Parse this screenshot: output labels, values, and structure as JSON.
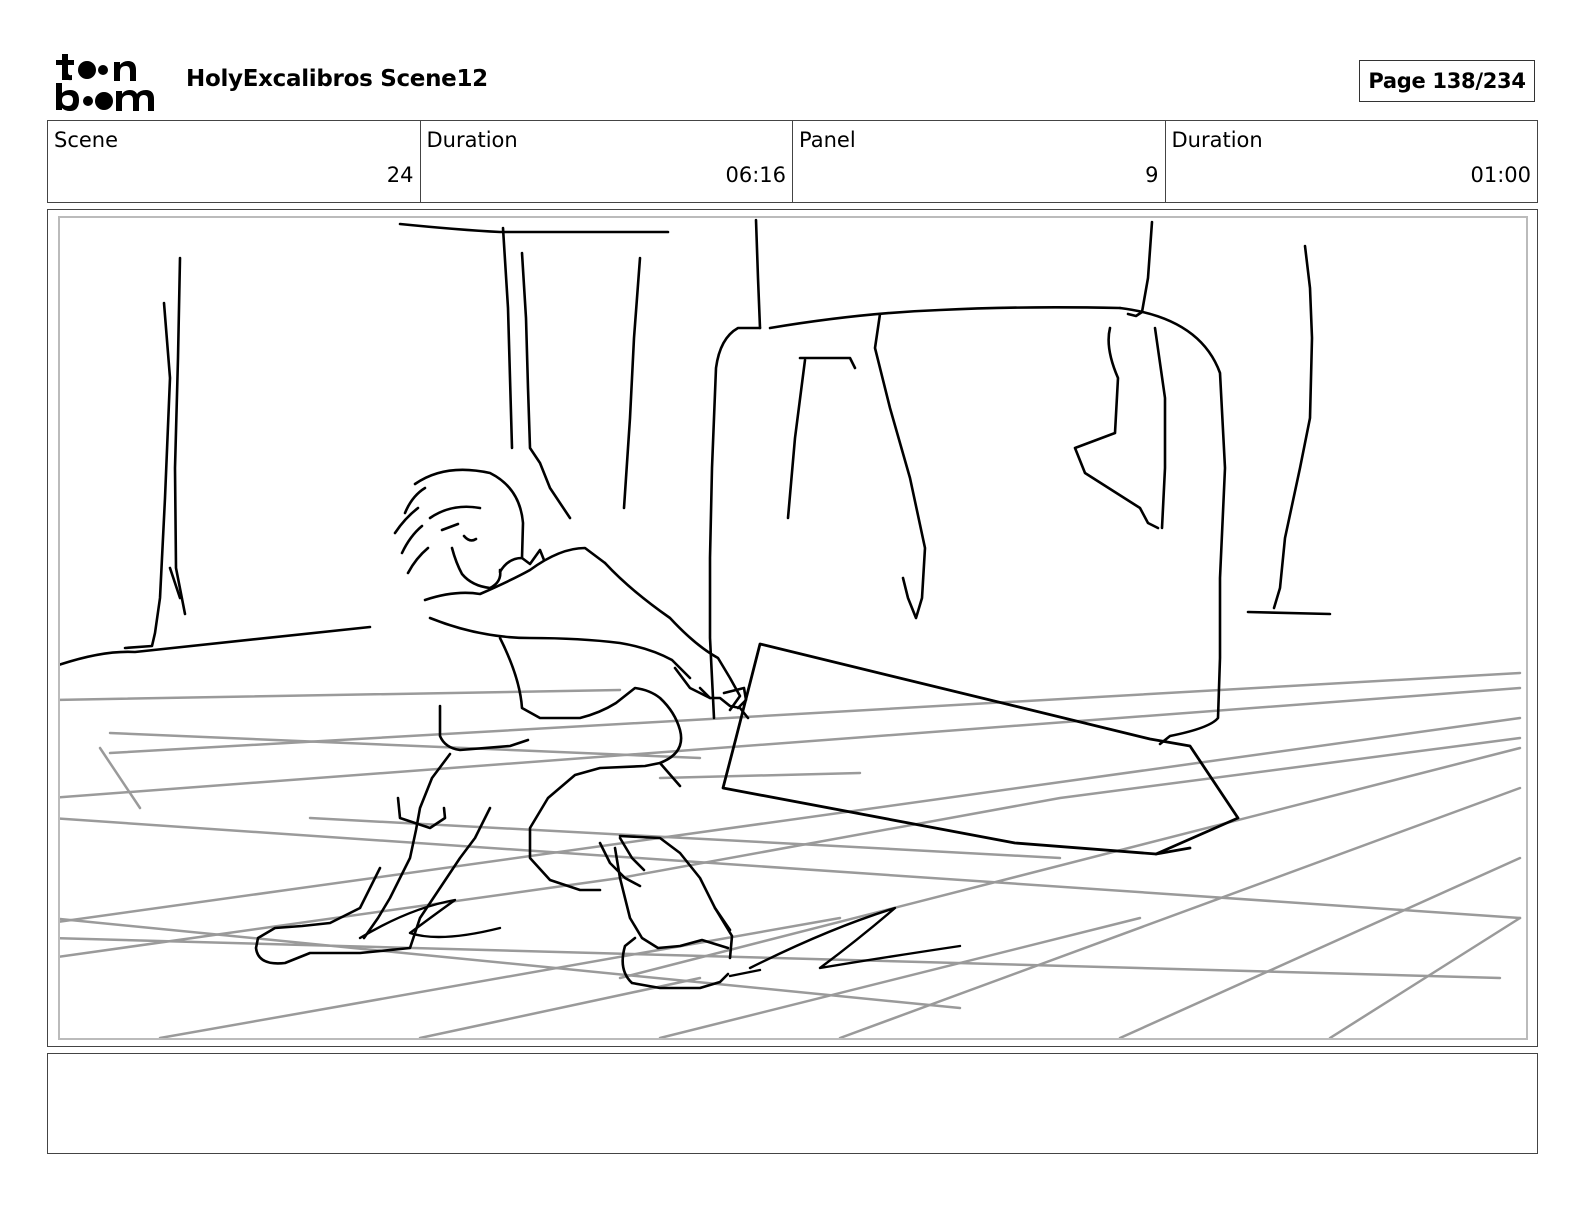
{
  "header": {
    "logo_top": "t●●n",
    "logo_bottom": "b●●m",
    "project_title": "HolyExcalibros Scene12",
    "page_label": "Page 138/234"
  },
  "info": {
    "scene_label": "Scene",
    "scene_value": "24",
    "scene_duration_label": "Duration",
    "scene_duration_value": "06:16",
    "panel_label": "Panel",
    "panel_value": "9",
    "panel_duration_label": "Duration",
    "panel_duration_value": "01:00"
  },
  "notes": {
    "text": ""
  },
  "colors": {
    "ink": "#000000",
    "floor_grid": "#9a9a9a",
    "frame_border": "#444444"
  }
}
